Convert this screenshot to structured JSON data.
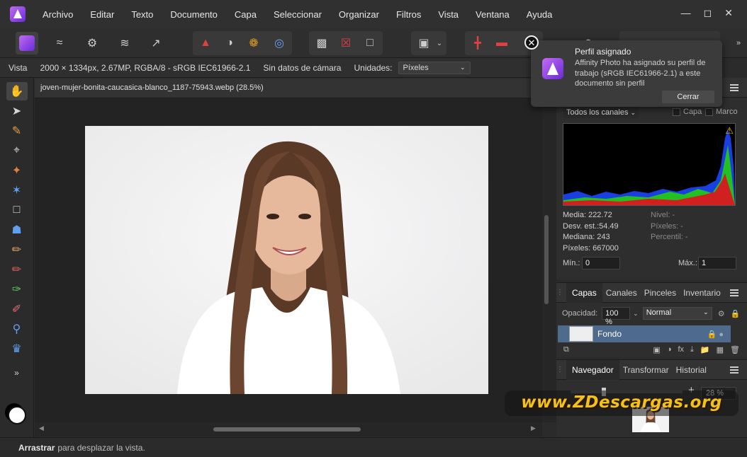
{
  "menu": [
    "Archivo",
    "Editar",
    "Texto",
    "Documento",
    "Capa",
    "Seleccionar",
    "Organizar",
    "Filtros",
    "Vista",
    "Ventana",
    "Ayuda"
  ],
  "context": {
    "label": "Vista",
    "doc_info": "2000 × 1334px, 2.67MP, RGBA/8 - sRGB IEC61966-2.1",
    "camera": "Sin datos de cámara",
    "units_label": "Unidades:",
    "units_value": "Píxeles"
  },
  "document": {
    "tab_title": "joven-mujer-bonita-caucasica-blanco_1187-75943.webp (28.5%)"
  },
  "histogram": {
    "channels": "Todos los canales",
    "opt_layer": "Capa",
    "opt_frame": "Marco",
    "stats": {
      "mean": "Media: 222.72",
      "stddev": "Desv. est.:54.49",
      "median": "Mediana: 243",
      "pixels": "Píxeles: 667000",
      "level": "Nivel: -",
      "level_pixels": "Píxeles: -",
      "percentile": "Percentil: -"
    },
    "min_label": "Mín.:",
    "min_value": "0",
    "max_label": "Máx.:",
    "max_value": "1"
  },
  "layers": {
    "tabs": [
      "Capas",
      "Canales",
      "Pinceles",
      "Inventario"
    ],
    "opacity_label": "Opacidad:",
    "opacity_value": "100 %",
    "blend_mode": "Normal",
    "layer_name": "Fondo"
  },
  "navigator": {
    "tabs": [
      "Navegador",
      "Transformar",
      "Historial"
    ],
    "zoom": "28 %",
    "zoom_fraction": 0.28
  },
  "notification": {
    "title": "Perfil asignado",
    "message": "Affinity Photo ha asignado su perfil de trabajo (sRGB IEC61966-2.1) a este documento sin perfil",
    "button": "Cerrar"
  },
  "status": {
    "action": "Arrastrar",
    "hint": "para desplazar la vista."
  },
  "watermark": "www.ZDescargas.org",
  "colors": {
    "accent": "#7a3ee0",
    "selected_layer": "#4e6a8d",
    "watermark": "#f3c21a"
  },
  "icons": {
    "tools": [
      "hand-icon",
      "move-icon",
      "color-picker-icon",
      "crop-icon",
      "selection-brush-icon",
      "flood-select-icon",
      "marquee-icon",
      "fill-icon",
      "paint-brush-icon",
      "clone-icon",
      "healing-icon",
      "zoom-icon",
      "stamp-icon",
      "more-tools-icon"
    ]
  }
}
